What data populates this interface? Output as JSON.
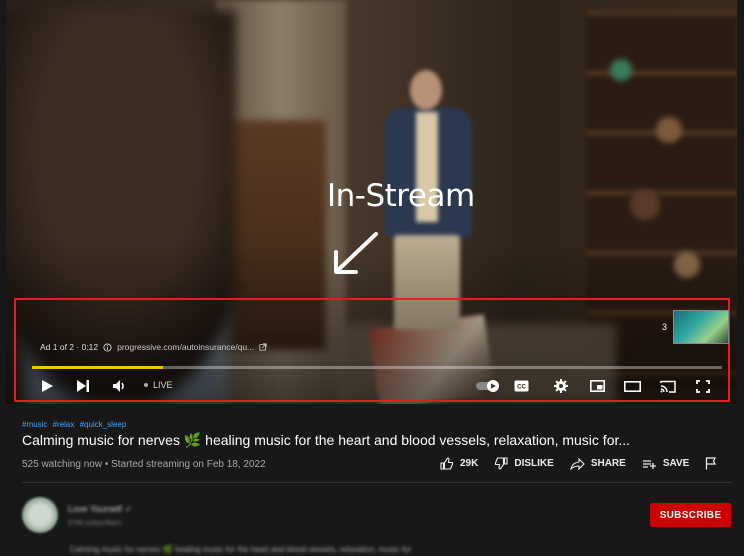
{
  "annotation": {
    "label": "In-Stream"
  },
  "ad": {
    "info": "Ad 1 of 2 · 0:12",
    "info_icon": "info-icon",
    "url": "progressive.com/autoinsurance/qu...",
    "external_icon": "external-link-icon",
    "thumb_count": "3",
    "progress": 0.19
  },
  "player": {
    "live_label": "LIVE"
  },
  "video": {
    "hashtags": [
      "#music",
      "#relax",
      "#quick_sleep"
    ],
    "title_part1": "Calming music for nerves ",
    "title_emoji": "🌿",
    "title_part2": " healing music for the heart and blood vessels, relaxation, music for...",
    "meta": "525 watching now • Started streaming on Feb 18, 2022"
  },
  "actions": {
    "like_count": "29K",
    "dislike_label": "DISLIKE",
    "share_label": "SHARE",
    "save_label": "SAVE"
  },
  "channel": {
    "name": "Love Yourself ✓",
    "subscribers": "5760 subscribers",
    "subscribe_label": "SUBSCRIBE",
    "description": "Calming music for nerves 🌿 healing music for the heart and blood vessels, relaxation, music for"
  },
  "colors": {
    "accent_progress": "#f4c200",
    "annotation_box": "#e41e1e",
    "subscribe_bg": "#cc0000",
    "hashtag": "#3ea6ff"
  }
}
